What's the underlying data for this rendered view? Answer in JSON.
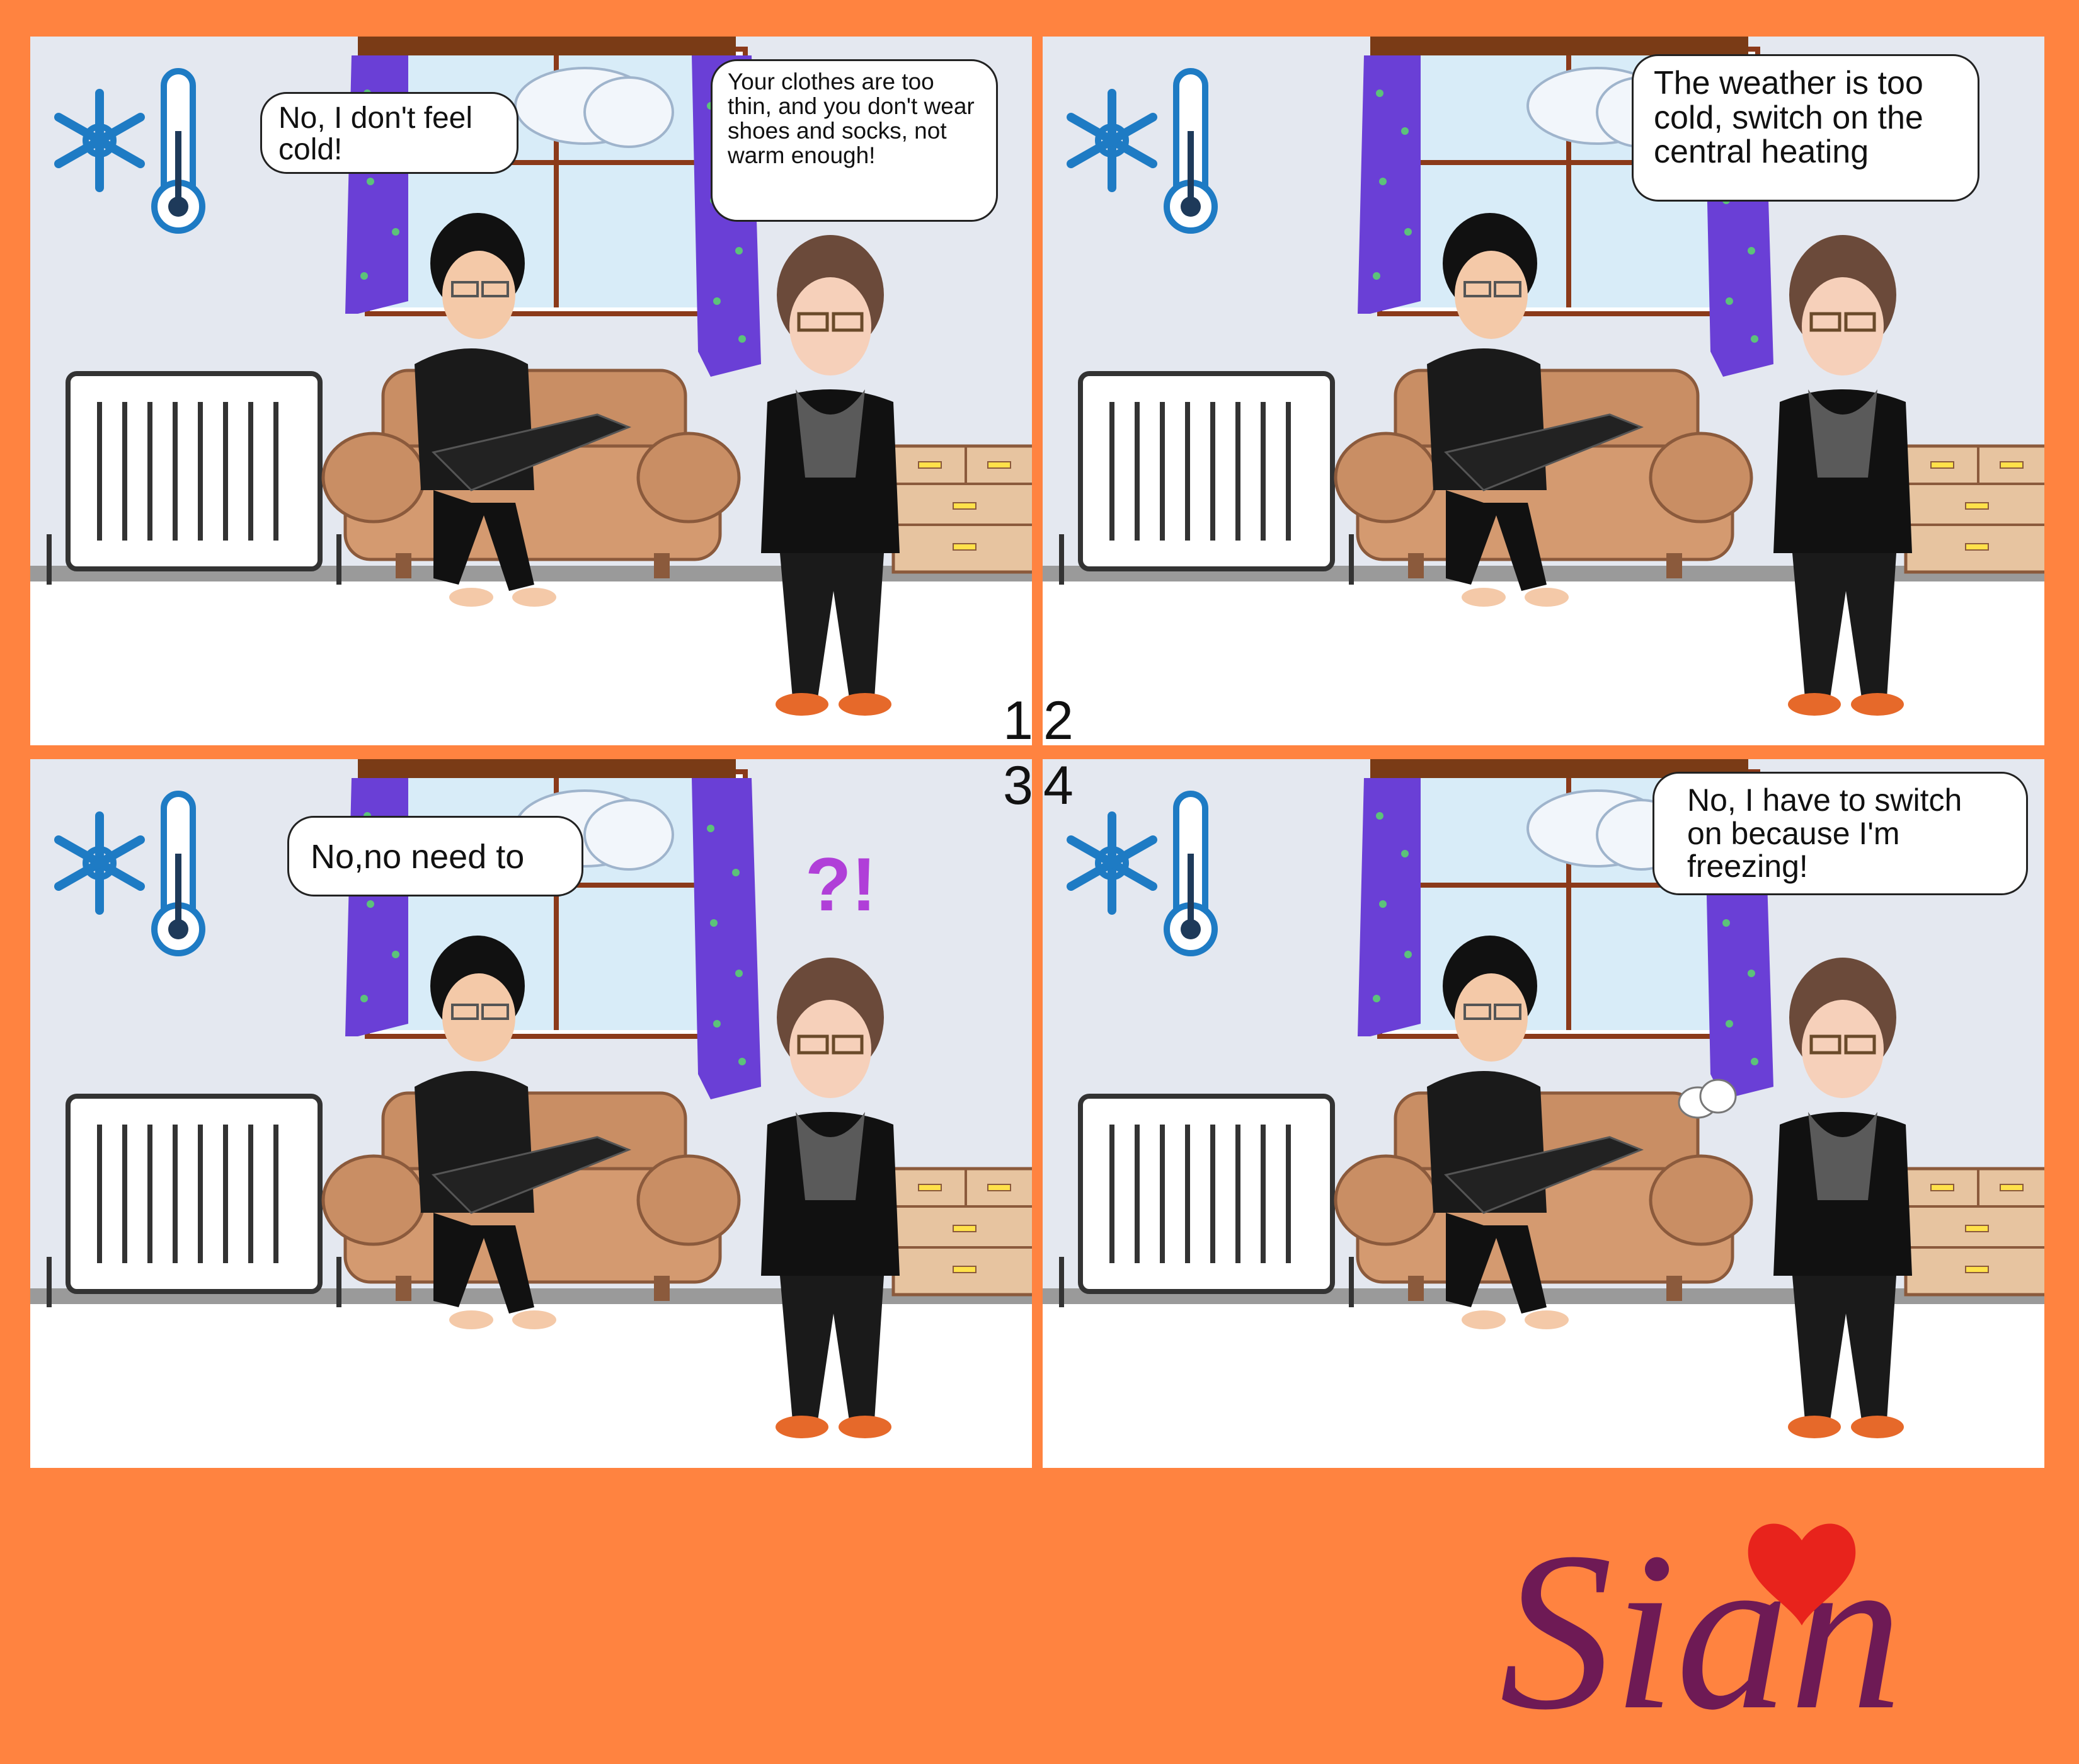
{
  "panels": [
    {
      "number": "1",
      "bubbles": [
        {
          "speaker": "man",
          "text": "No, I don't feel cold!"
        },
        {
          "speaker": "woman",
          "text": "Your clothes are too thin, and you don't wear shoes and socks, not warm enough!"
        }
      ]
    },
    {
      "number": "2",
      "bubbles": [
        {
          "speaker": "woman",
          "text": "The weather is too cold, switch on the central heating"
        }
      ]
    },
    {
      "number": "3",
      "bubbles": [
        {
          "speaker": "man",
          "text": "No,no need to"
        }
      ],
      "icon": "question-exclamation-icon"
    },
    {
      "number": "4",
      "bubbles": [
        {
          "speaker": "woman",
          "text": "No, I have to switch on because I'm freezing!"
        }
      ]
    }
  ],
  "logo": {
    "text": "Sian",
    "icon": "heart-icon"
  },
  "colors": {
    "background": "#FF8340",
    "wall": "#E4E8F0",
    "floor": "#FFFFFF",
    "logo": "#6E1A55",
    "heart": "#E8231C",
    "curtain": "#6A3FD6",
    "sofa": "#C98E64"
  }
}
